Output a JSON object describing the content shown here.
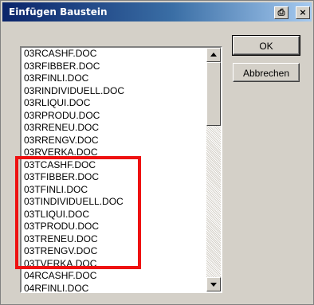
{
  "window": {
    "title": "Einfügen Baustein",
    "print_glyph": "⎙",
    "close_glyph": "×"
  },
  "list": {
    "items": [
      "03RCASHF.DOC",
      "03RFIBBER.DOC",
      "03RFINLI.DOC",
      "03RINDIVIDUELL.DOC",
      "03RLIQUI.DOC",
      "03RPRODU.DOC",
      "03RRENEU.DOC",
      "03RRENGV.DOC",
      "03RVERKA.DOC",
      "03TCASHF.DOC",
      "03TFIBBER.DOC",
      "03TFINLI.DOC",
      "03TINDIVIDUELL.DOC",
      "03TLIQUI.DOC",
      "03TPRODU.DOC",
      "03TRENEU.DOC",
      "03TRENGV.DOC",
      "03TVERKA.DOC",
      "04RCASHF.DOC",
      "04RFINLI.DOC"
    ]
  },
  "buttons": {
    "ok_label": "OK",
    "cancel_label": "Abbrechen"
  },
  "colors": {
    "highlight": "#ee1111",
    "title_bar_start": "#0a246a",
    "title_bar_end": "#a6caf0",
    "dialog_face": "#d4d0c8"
  }
}
